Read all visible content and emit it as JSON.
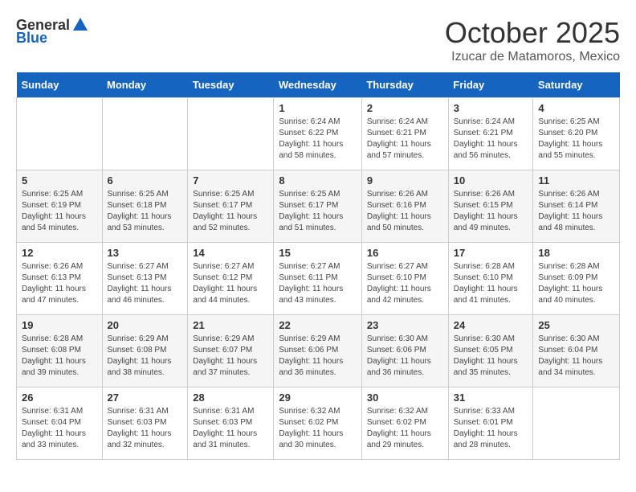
{
  "header": {
    "logo_general": "General",
    "logo_blue": "Blue",
    "month_title": "October 2025",
    "subtitle": "Izucar de Matamoros, Mexico"
  },
  "days_of_week": [
    "Sunday",
    "Monday",
    "Tuesday",
    "Wednesday",
    "Thursday",
    "Friday",
    "Saturday"
  ],
  "weeks": [
    [
      {
        "day": "",
        "info": ""
      },
      {
        "day": "",
        "info": ""
      },
      {
        "day": "",
        "info": ""
      },
      {
        "day": "1",
        "info": "Sunrise: 6:24 AM\nSunset: 6:22 PM\nDaylight: 11 hours\nand 58 minutes."
      },
      {
        "day": "2",
        "info": "Sunrise: 6:24 AM\nSunset: 6:21 PM\nDaylight: 11 hours\nand 57 minutes."
      },
      {
        "day": "3",
        "info": "Sunrise: 6:24 AM\nSunset: 6:21 PM\nDaylight: 11 hours\nand 56 minutes."
      },
      {
        "day": "4",
        "info": "Sunrise: 6:25 AM\nSunset: 6:20 PM\nDaylight: 11 hours\nand 55 minutes."
      }
    ],
    [
      {
        "day": "5",
        "info": "Sunrise: 6:25 AM\nSunset: 6:19 PM\nDaylight: 11 hours\nand 54 minutes."
      },
      {
        "day": "6",
        "info": "Sunrise: 6:25 AM\nSunset: 6:18 PM\nDaylight: 11 hours\nand 53 minutes."
      },
      {
        "day": "7",
        "info": "Sunrise: 6:25 AM\nSunset: 6:17 PM\nDaylight: 11 hours\nand 52 minutes."
      },
      {
        "day": "8",
        "info": "Sunrise: 6:25 AM\nSunset: 6:17 PM\nDaylight: 11 hours\nand 51 minutes."
      },
      {
        "day": "9",
        "info": "Sunrise: 6:26 AM\nSunset: 6:16 PM\nDaylight: 11 hours\nand 50 minutes."
      },
      {
        "day": "10",
        "info": "Sunrise: 6:26 AM\nSunset: 6:15 PM\nDaylight: 11 hours\nand 49 minutes."
      },
      {
        "day": "11",
        "info": "Sunrise: 6:26 AM\nSunset: 6:14 PM\nDaylight: 11 hours\nand 48 minutes."
      }
    ],
    [
      {
        "day": "12",
        "info": "Sunrise: 6:26 AM\nSunset: 6:13 PM\nDaylight: 11 hours\nand 47 minutes."
      },
      {
        "day": "13",
        "info": "Sunrise: 6:27 AM\nSunset: 6:13 PM\nDaylight: 11 hours\nand 46 minutes."
      },
      {
        "day": "14",
        "info": "Sunrise: 6:27 AM\nSunset: 6:12 PM\nDaylight: 11 hours\nand 44 minutes."
      },
      {
        "day": "15",
        "info": "Sunrise: 6:27 AM\nSunset: 6:11 PM\nDaylight: 11 hours\nand 43 minutes."
      },
      {
        "day": "16",
        "info": "Sunrise: 6:27 AM\nSunset: 6:10 PM\nDaylight: 11 hours\nand 42 minutes."
      },
      {
        "day": "17",
        "info": "Sunrise: 6:28 AM\nSunset: 6:10 PM\nDaylight: 11 hours\nand 41 minutes."
      },
      {
        "day": "18",
        "info": "Sunrise: 6:28 AM\nSunset: 6:09 PM\nDaylight: 11 hours\nand 40 minutes."
      }
    ],
    [
      {
        "day": "19",
        "info": "Sunrise: 6:28 AM\nSunset: 6:08 PM\nDaylight: 11 hours\nand 39 minutes."
      },
      {
        "day": "20",
        "info": "Sunrise: 6:29 AM\nSunset: 6:08 PM\nDaylight: 11 hours\nand 38 minutes."
      },
      {
        "day": "21",
        "info": "Sunrise: 6:29 AM\nSunset: 6:07 PM\nDaylight: 11 hours\nand 37 minutes."
      },
      {
        "day": "22",
        "info": "Sunrise: 6:29 AM\nSunset: 6:06 PM\nDaylight: 11 hours\nand 36 minutes."
      },
      {
        "day": "23",
        "info": "Sunrise: 6:30 AM\nSunset: 6:06 PM\nDaylight: 11 hours\nand 36 minutes."
      },
      {
        "day": "24",
        "info": "Sunrise: 6:30 AM\nSunset: 6:05 PM\nDaylight: 11 hours\nand 35 minutes."
      },
      {
        "day": "25",
        "info": "Sunrise: 6:30 AM\nSunset: 6:04 PM\nDaylight: 11 hours\nand 34 minutes."
      }
    ],
    [
      {
        "day": "26",
        "info": "Sunrise: 6:31 AM\nSunset: 6:04 PM\nDaylight: 11 hours\nand 33 minutes."
      },
      {
        "day": "27",
        "info": "Sunrise: 6:31 AM\nSunset: 6:03 PM\nDaylight: 11 hours\nand 32 minutes."
      },
      {
        "day": "28",
        "info": "Sunrise: 6:31 AM\nSunset: 6:03 PM\nDaylight: 11 hours\nand 31 minutes."
      },
      {
        "day": "29",
        "info": "Sunrise: 6:32 AM\nSunset: 6:02 PM\nDaylight: 11 hours\nand 30 minutes."
      },
      {
        "day": "30",
        "info": "Sunrise: 6:32 AM\nSunset: 6:02 PM\nDaylight: 11 hours\nand 29 minutes."
      },
      {
        "day": "31",
        "info": "Sunrise: 6:33 AM\nSunset: 6:01 PM\nDaylight: 11 hours\nand 28 minutes."
      },
      {
        "day": "",
        "info": ""
      }
    ]
  ]
}
